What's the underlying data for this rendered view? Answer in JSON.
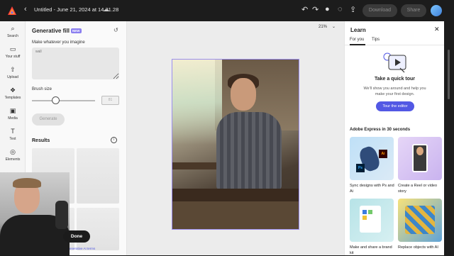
{
  "topbar": {
    "doc_title": "Untitled - June 21, 2024 at 14.21.28",
    "download_label": "Download",
    "share_label": "Share"
  },
  "rail": {
    "items": [
      {
        "label": "Search",
        "icon": "search-icon"
      },
      {
        "label": "Your stuff",
        "icon": "folder-icon"
      },
      {
        "label": "Upload",
        "icon": "upload-icon"
      },
      {
        "label": "Templates",
        "icon": "templates-icon"
      },
      {
        "label": "Media",
        "icon": "media-icon"
      },
      {
        "label": "Text",
        "icon": "text-icon"
      },
      {
        "label": "Elements",
        "icon": "elements-icon"
      }
    ]
  },
  "gen_fill": {
    "title": "Generative fill",
    "badge": "NEW",
    "prompt_label": "Make whatever you imagine",
    "prompt_placeholder": "wall",
    "brush_label": "Brush size",
    "brush_value": "81",
    "brush_level": 0.38,
    "generate_label": "Generate",
    "results_label": "Results",
    "done_label": "Done",
    "terms_label": "enerative AI terms"
  },
  "canvas": {
    "zoom": "21%"
  },
  "learn": {
    "title": "Learn",
    "tabs": [
      "For you",
      "Tips"
    ],
    "tour_title": "Take a quick tour",
    "tour_desc": "We'll show you around and help you make your first design.",
    "tour_button": "Tour the editor",
    "section_title": "Adobe Express in 30 seconds",
    "cards": [
      {
        "label": "Sync designs with Ps and Ai"
      },
      {
        "label": "Create a Reel or video story"
      },
      {
        "label": "Make and share a brand kit"
      },
      {
        "label": "Replace objects with AI"
      }
    ]
  },
  "colors": {
    "accent": "#5258e4",
    "badge": "#8b7ff0"
  }
}
